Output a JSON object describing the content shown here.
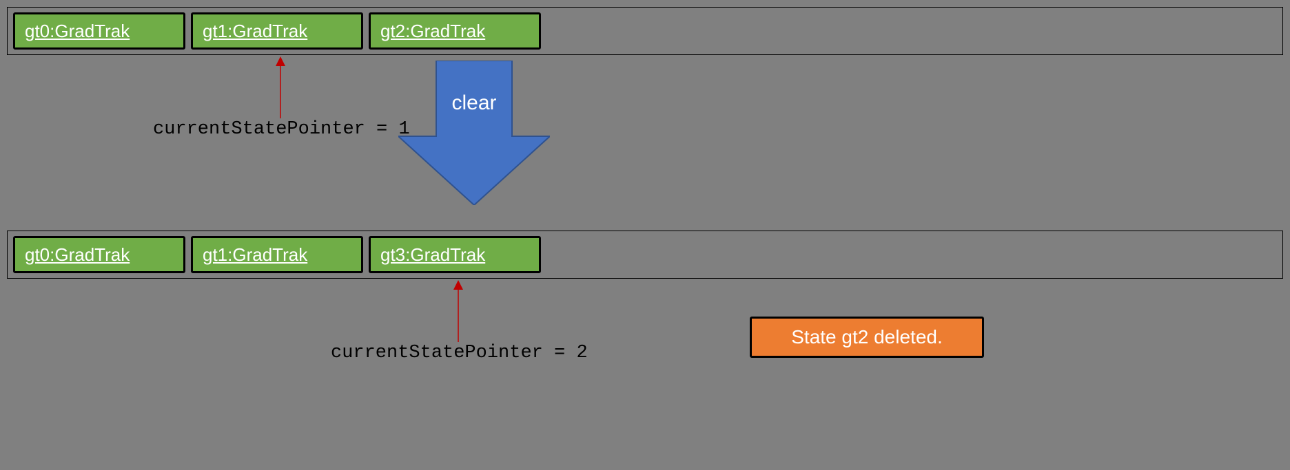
{
  "before": {
    "states": [
      {
        "label": "gt0:GradTrak"
      },
      {
        "label": "gt1:GradTrak"
      },
      {
        "label": "gt2:GradTrak"
      }
    ],
    "pointer_label": "currentStatePointer = 1"
  },
  "after": {
    "states": [
      {
        "label": "gt0:GradTrak"
      },
      {
        "label": "gt1:GradTrak"
      },
      {
        "label": "gt3:GradTrak"
      }
    ],
    "pointer_label": "currentStatePointer = 2"
  },
  "transition_label": "clear",
  "callout": "State gt2 deleted."
}
